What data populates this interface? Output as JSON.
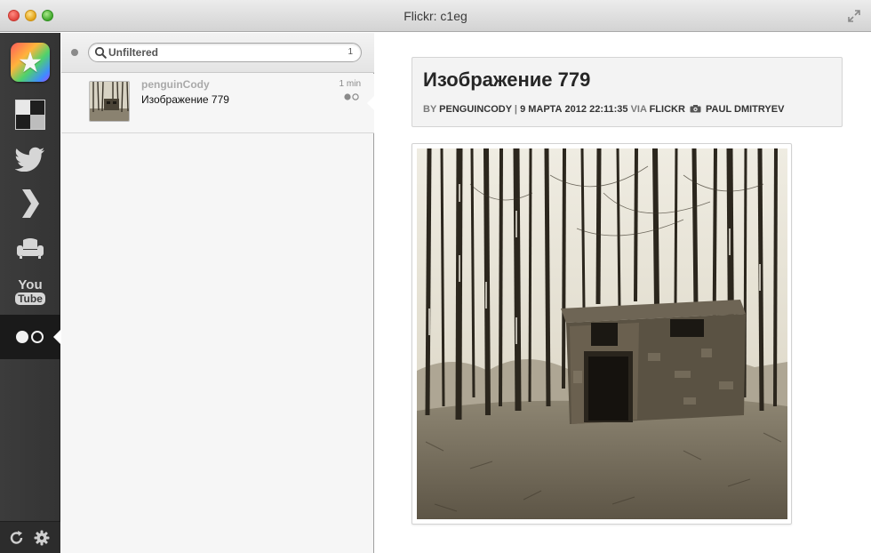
{
  "window": {
    "title": "Flickr: c1eg"
  },
  "services": [
    {
      "name": "app-logo",
      "active": false
    },
    {
      "name": "delicious",
      "active": false
    },
    {
      "name": "twitter",
      "active": false
    },
    {
      "name": "chevron",
      "active": false
    },
    {
      "name": "couch",
      "active": false
    },
    {
      "name": "youtube",
      "active": false
    },
    {
      "name": "flickr",
      "active": true
    }
  ],
  "youtube": {
    "top": "You",
    "bottom": "Tube"
  },
  "filter": {
    "label": "Unfiltered",
    "count": "1"
  },
  "timeline": {
    "items": [
      {
        "author": "penguinCody",
        "caption": "Изображение 779",
        "time": "1 min"
      }
    ]
  },
  "detail": {
    "title": "Изображение 779",
    "meta": {
      "by": "BY",
      "author": "PENGUINCODY",
      "separator": "|",
      "date": "9 МАРТА 2012 22:11:35",
      "via": "VIA",
      "service": "FLICKR",
      "camera_owner": "PAUL DMITRYEV"
    }
  },
  "colors": {
    "sidebar": "#3a3a3a",
    "active_service": "#1a1a1a",
    "timeline_bg": "#f6f6f6",
    "header_card": "#f3f3f3",
    "photo_tone": "#c9c2ad"
  }
}
